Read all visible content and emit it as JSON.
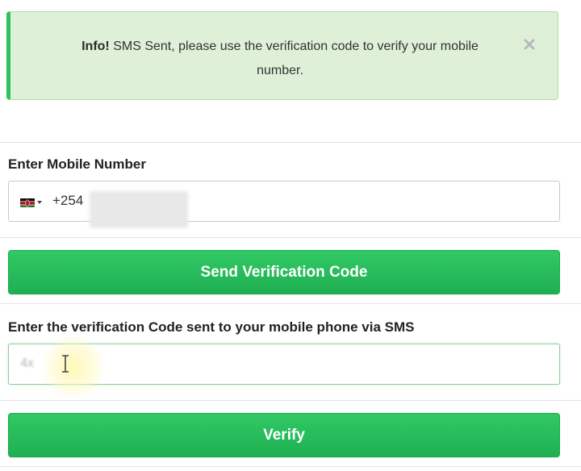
{
  "alert": {
    "prefix": "Info!",
    "message": "SMS Sent, please use the verification code to verify your mobile number.",
    "close_icon": "close-icon",
    "background": "#dff0d8",
    "accent": "#2ec25c"
  },
  "mobile": {
    "label": "Enter Mobile Number",
    "flag_icon": "kenya-flag-icon",
    "dial_code": "+254"
  },
  "send_button": {
    "label": "Send Verification Code"
  },
  "verification": {
    "label": "Enter the verification Code sent to your mobile phone via SMS",
    "value": "4x"
  },
  "verify_button": {
    "label": "Verify"
  },
  "colors": {
    "button_green": "#22b455",
    "text": "#222222"
  }
}
